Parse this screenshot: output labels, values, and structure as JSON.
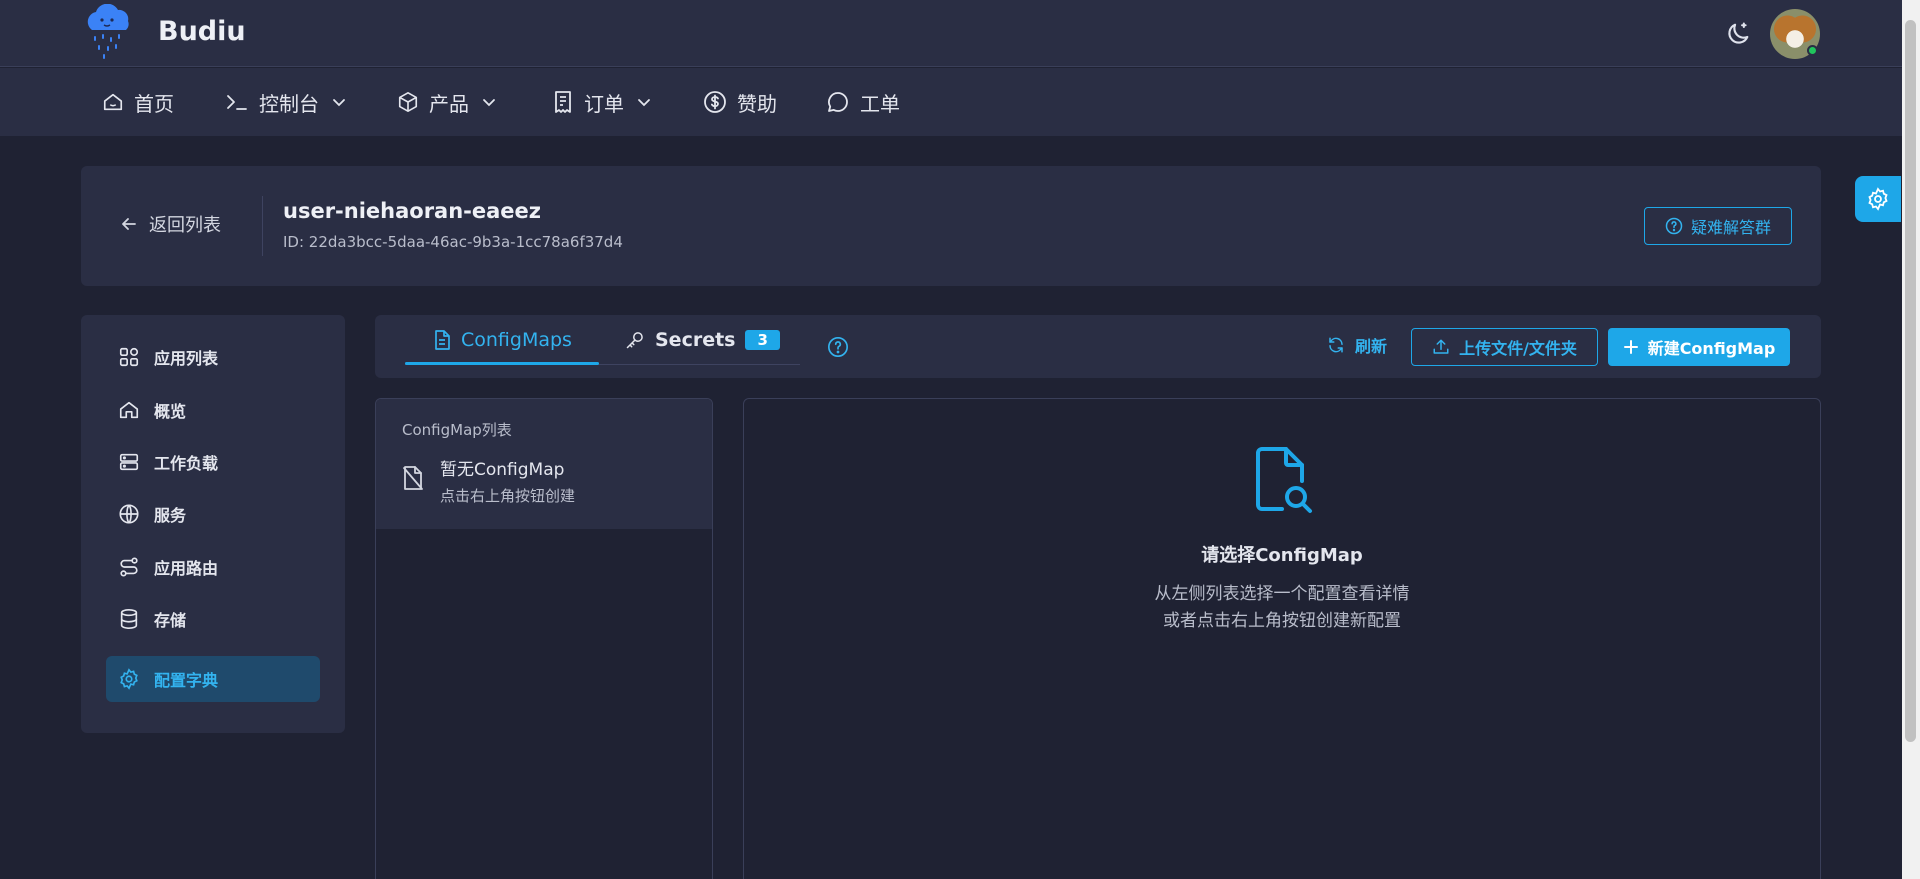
{
  "brand": {
    "name": "Budiu"
  },
  "nav": {
    "items": [
      {
        "label": "首页",
        "icon": "home-icon"
      },
      {
        "label": "控制台",
        "icon": "terminal-icon"
      },
      {
        "label": "产品",
        "icon": "cube-icon"
      },
      {
        "label": "订单",
        "icon": "receipt-icon"
      },
      {
        "label": "赞助",
        "icon": "dollar-icon"
      },
      {
        "label": "工单",
        "icon": "chat-icon"
      }
    ]
  },
  "header": {
    "back_label": "返回列表",
    "app_name": "user-niehaoran-eaeez",
    "app_id": "ID: 22da3bcc-5daa-46ac-9b3a-1cc78a6f37d4",
    "help_label": "疑难解答群"
  },
  "sidebar": {
    "items": [
      {
        "label": "应用列表",
        "icon": "apps-icon"
      },
      {
        "label": "概览",
        "icon": "home-icon"
      },
      {
        "label": "工作负载",
        "icon": "server-icon"
      },
      {
        "label": "服务",
        "icon": "globe-icon"
      },
      {
        "label": "应用路由",
        "icon": "route-icon"
      },
      {
        "label": "存储",
        "icon": "database-icon"
      },
      {
        "label": "配置字典",
        "icon": "gear-icon",
        "active": true
      }
    ]
  },
  "tabs": {
    "configmaps_label": "ConfigMaps",
    "secrets_label": "Secrets",
    "secrets_count": "3",
    "refresh_label": "刷新",
    "upload_label": "上传文件/文件夹",
    "create_label": "新建ConfigMap"
  },
  "list": {
    "title": "ConfigMap列表",
    "empty_title": "暂无ConfigMap",
    "empty_sub": "点击右上角按钮创建"
  },
  "detail": {
    "title": "请选择ConfigMap",
    "line1": "从左侧列表选择一个配置查看详情",
    "line2": "或者点击右上角按钮创建新配置"
  },
  "colors": {
    "accent": "#1ea7e8",
    "background": "#1f2233",
    "panel": "#2a2e44",
    "active_bg": "#1f4a6c"
  }
}
